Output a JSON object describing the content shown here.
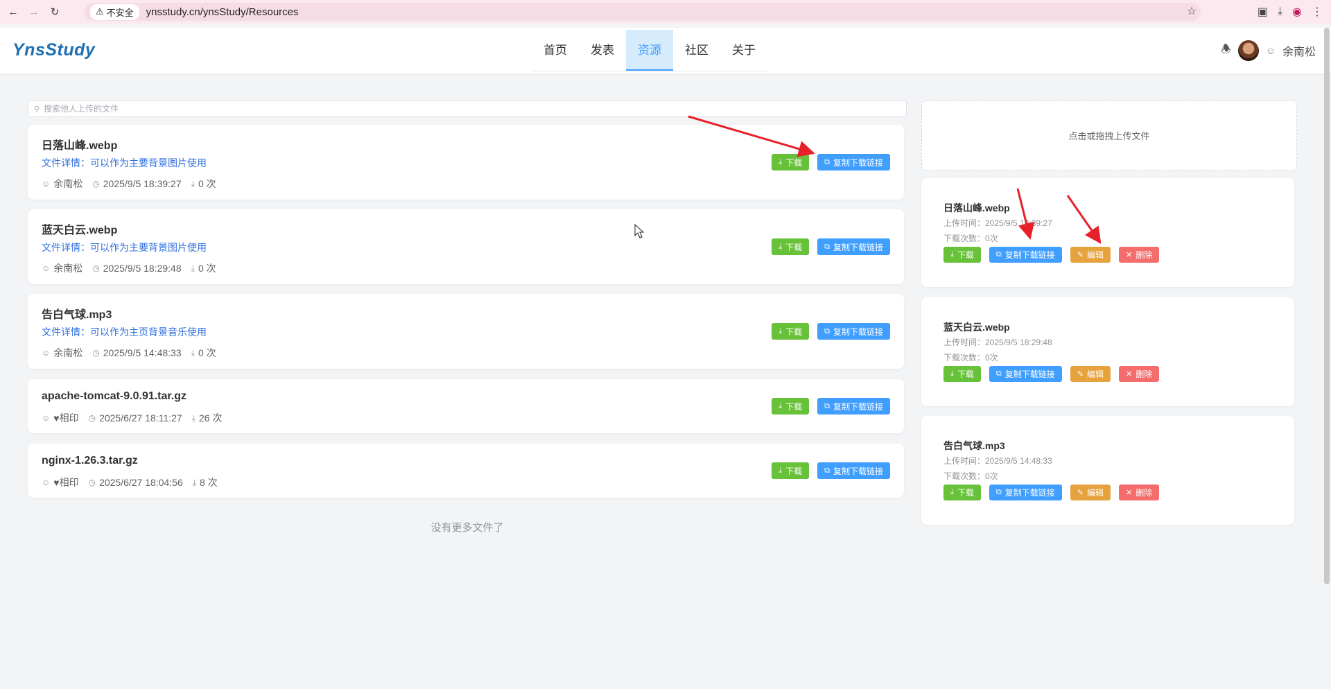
{
  "browser": {
    "insecure_label": "不安全",
    "url": "ynsstudy.cn/ynsStudy/Resources"
  },
  "header": {
    "logo": "YnsStudy",
    "menu": [
      {
        "label": "首页"
      },
      {
        "label": "发表"
      },
      {
        "label": "资源"
      },
      {
        "label": "社区"
      },
      {
        "label": "关于"
      }
    ],
    "active_menu": "资源",
    "username": "余南松"
  },
  "search": {
    "placeholder": "搜索他人上传的文件"
  },
  "files": [
    {
      "name": "日落山峰.webp",
      "desc": "文件详情：可以作为主要背景图片使用",
      "uploader": "余南松",
      "time": "2025/9/5 18:39:27",
      "downloads": "0 次"
    },
    {
      "name": "蓝天白云.webp",
      "desc": "文件详情：可以作为主要背景图片使用",
      "uploader": "余南松",
      "time": "2025/9/5 18:29:48",
      "downloads": "0 次"
    },
    {
      "name": "告白气球.mp3",
      "desc": "文件详情：可以作为主页背景音乐使用",
      "uploader": "余南松",
      "time": "2025/9/5 14:48:33",
      "downloads": "0 次"
    },
    {
      "name": "apache-tomcat-9.0.91.tar.gz",
      "desc": "",
      "uploader": "♥相印",
      "time": "2025/6/27 18:11:27",
      "downloads": "26 次"
    },
    {
      "name": "nginx-1.26.3.tar.gz",
      "desc": "",
      "uploader": "♥相印",
      "time": "2025/6/27 18:04:56",
      "downloads": "8 次"
    }
  ],
  "buttons": {
    "download": "下载",
    "copy_link": "复制下载链接",
    "edit": "编辑",
    "delete": "删除"
  },
  "no_more": "没有更多文件了",
  "upload": {
    "label": "点击或拖拽上传文件"
  },
  "my_files": [
    {
      "name": "日落山峰.webp",
      "time": "上传时间：2025/9/5 18:39:27",
      "count": "下载次数：0次"
    },
    {
      "name": "蓝天白云.webp",
      "time": "上传时间：2025/9/5 18:29:48",
      "count": "下载次数：0次"
    },
    {
      "name": "告白气球.mp3",
      "time": "上传时间：2025/9/5 14:48:33",
      "count": "下载次数：0次"
    }
  ],
  "colors": {
    "accent": "#409eff",
    "success": "#67c23a",
    "warning": "#e6a23c",
    "danger": "#f56c6c",
    "annotation_arrow": "#e8202a"
  }
}
